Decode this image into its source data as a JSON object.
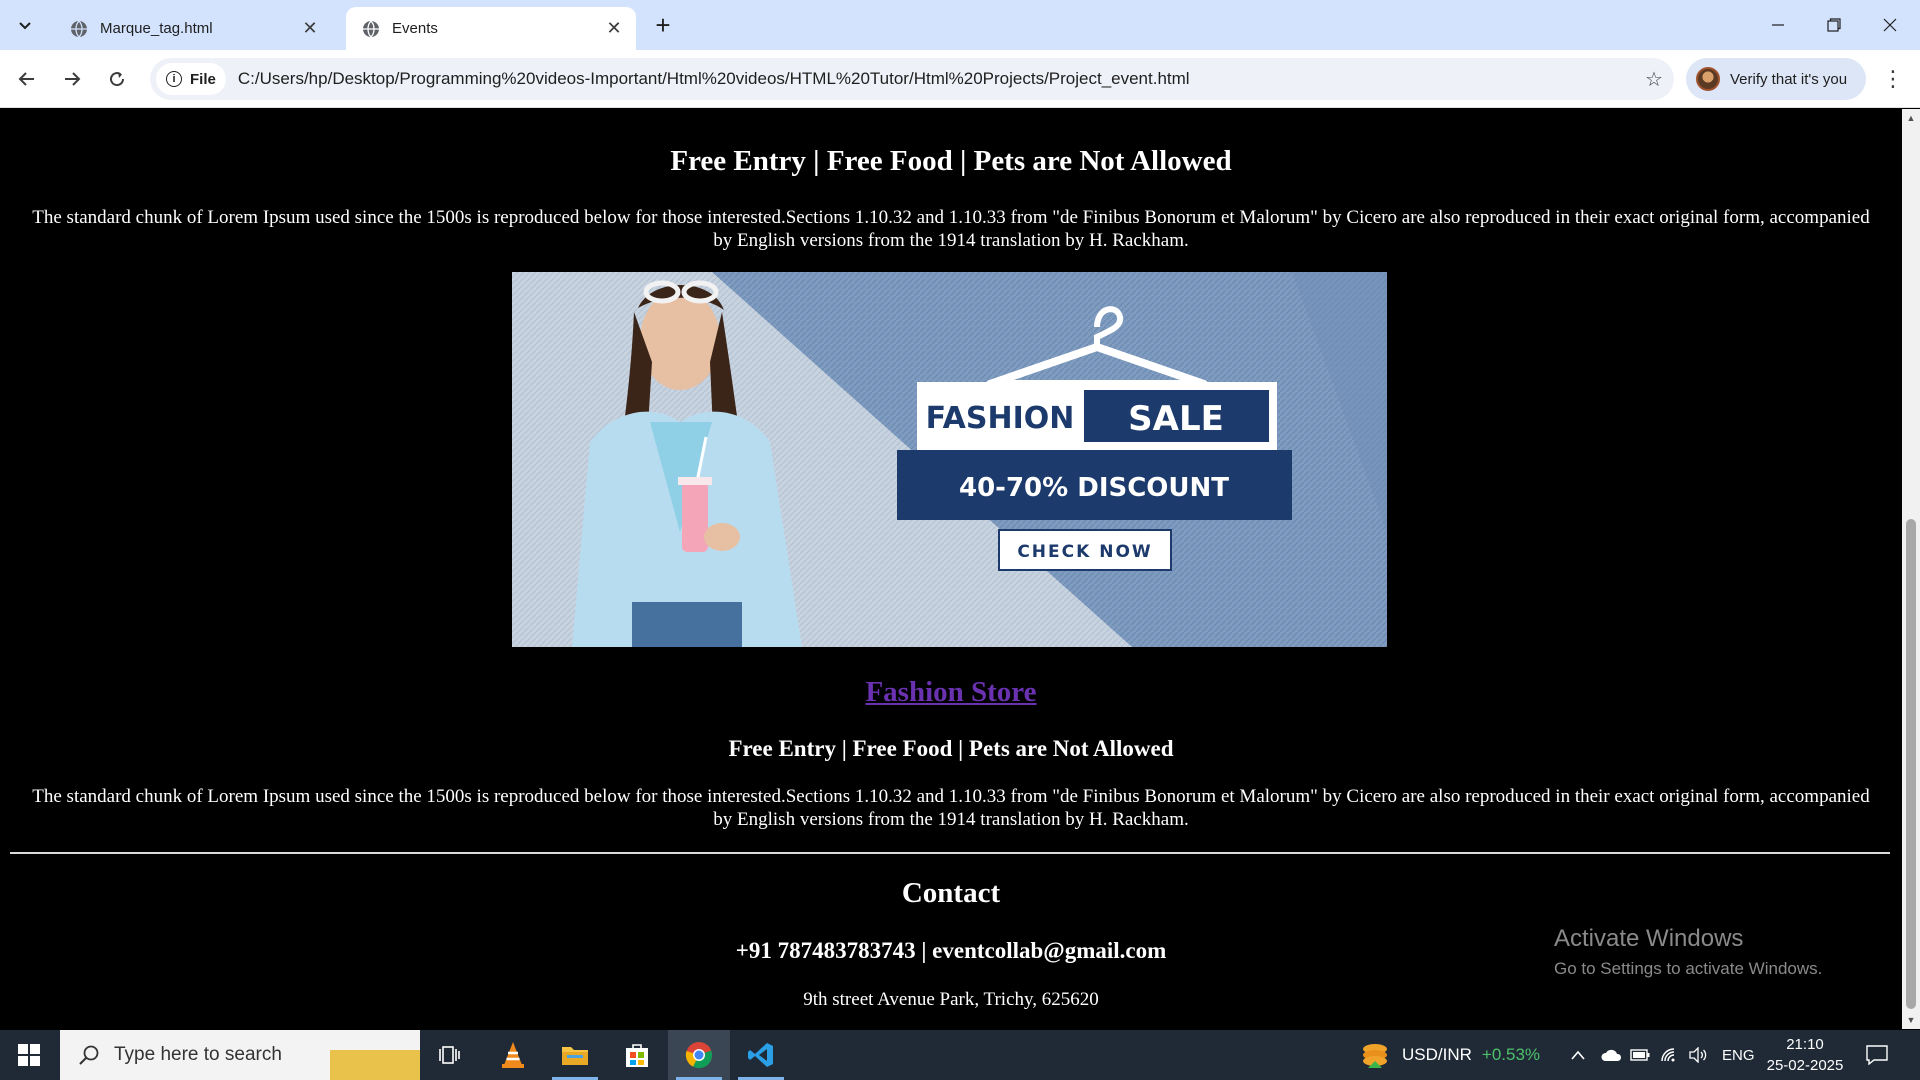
{
  "browser": {
    "tabs": [
      {
        "title": "Marque_tag.html",
        "active": false
      },
      {
        "title": "Events",
        "active": true
      }
    ],
    "site_chip": "File",
    "url": "C:/Users/hp/Desktop/Programming%20videos-Important/Html%20videos/HTML%20Tutor/Html%20Projects/Project_event.html",
    "verify_label": "Verify that it's you"
  },
  "page": {
    "entry_heading": "Free Entry | Free Food | Pets are Not Allowed",
    "description": "The standard chunk of Lorem Ipsum used since the 1500s is reproduced below for those interested.Sections 1.10.32 and 1.10.33 from \"de Finibus Bonorum et Malorum\" by Cicero are also reproduced in their exact original form, accompanied by English versions from the 1914 translation by H. Rackham.",
    "banner": {
      "fashion": "FASHION",
      "sale": "SALE",
      "discount": "40-70% DISCOUNT",
      "cta": "CHECK NOW"
    },
    "store_link": "Fashion Store",
    "contact_heading": "Contact",
    "contact_line": "+91 787483783743 | eventcollab@gmail.com",
    "address": "9th street Avenue Park, Trichy, 625620"
  },
  "watermark": {
    "title": "Activate Windows",
    "subtitle": "Go to Settings to activate Windows."
  },
  "taskbar": {
    "search_placeholder": "Type here to search",
    "ticker_label": "USD/INR",
    "ticker_change": "+0.53%",
    "language": "ENG",
    "time": "21:10",
    "date": "25-02-2025"
  },
  "colors": {
    "tabstrip": "#d3e3fd",
    "link_visited": "#6a32b0",
    "banner_navy": "#1c3a6b",
    "ticker_up": "#4ec06a"
  }
}
